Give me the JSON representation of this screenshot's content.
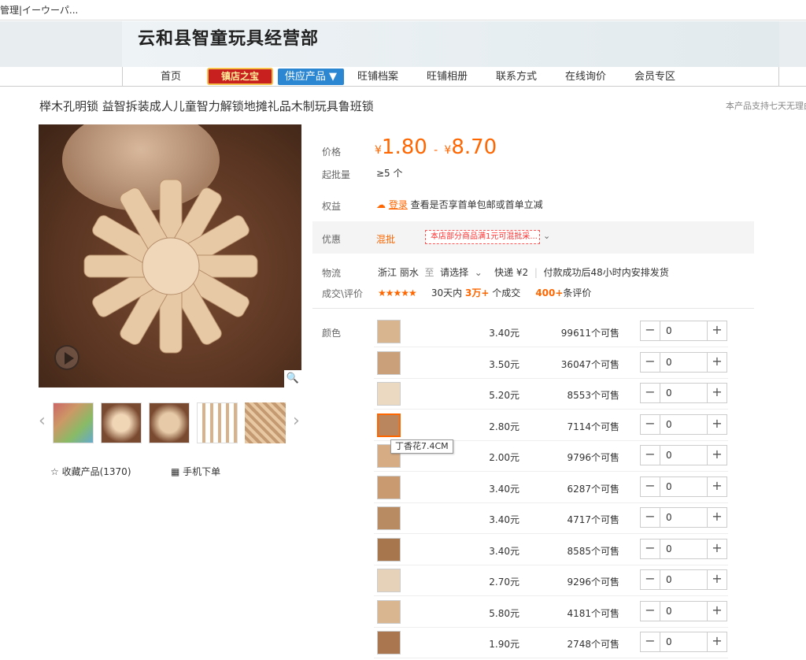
{
  "window": {
    "tab_title": "管理|イーウーパ..."
  },
  "shop": {
    "name": "云和县智童玩具经营部"
  },
  "nav": {
    "home": "首页",
    "treasure": "镇店之宝",
    "supply": "供应产品 ▼",
    "archive": "旺铺档案",
    "album": "旺铺相册",
    "contact": "联系方式",
    "inquiry": "在线询价",
    "member": "会员专区"
  },
  "product": {
    "title": "榉木孔明锁 益智拆装成人儿童智力解锁地摊礼品木制玩具鲁班锁",
    "support_note": "本产品支持七天无理由"
  },
  "gallery": {
    "collect": "收藏产品(1370)",
    "mobile": "手机下单"
  },
  "info": {
    "price_label": "价格",
    "price_low": "1.80",
    "price_sep": "-",
    "price_high": "8.70",
    "currency": "¥",
    "min_label": "起批量",
    "min_value": "≥5 个",
    "benefit_label": "权益",
    "benefit_link": "登录",
    "benefit_text": "查看是否享首单包邮或首单立减",
    "promo_label": "优惠",
    "promo_mix": "混批",
    "promo_tag": "本店部分商品满1元可混批采...",
    "logistics_label": "物流",
    "origin": "浙江 丽水",
    "to": "至",
    "dest": "请选择",
    "express": "快递 ¥2",
    "ship_note": "付款成功后48小时内安排发货",
    "deal_label": "成交\\评价",
    "days": "30天内",
    "deals": "3万+",
    "deals_unit": "个成交",
    "reviews": "400+",
    "reviews_unit": "条评价",
    "color_label": "颜色"
  },
  "rating": {
    "stars": 4.5,
    "stars_text": "★★★★★"
  },
  "tooltip": "丁香花7.4CM",
  "sku_unit": "个可售",
  "skus": [
    {
      "price": "3.40元",
      "stock": "99611",
      "qty": "0"
    },
    {
      "price": "3.50元",
      "stock": "36047",
      "qty": "0"
    },
    {
      "price": "5.20元",
      "stock": "8553",
      "qty": "0"
    },
    {
      "price": "2.80元",
      "stock": "7114",
      "qty": "0"
    },
    {
      "price": "2.00元",
      "stock": "9796",
      "qty": "0"
    },
    {
      "price": "3.40元",
      "stock": "6287",
      "qty": "0"
    },
    {
      "price": "3.40元",
      "stock": "4717",
      "qty": "0"
    },
    {
      "price": "3.40元",
      "stock": "8585",
      "qty": "0"
    },
    {
      "price": "2.70元",
      "stock": "9296",
      "qty": "0"
    },
    {
      "price": "5.80元",
      "stock": "4181",
      "qty": "0"
    },
    {
      "price": "1.90元",
      "stock": "2748",
      "qty": "0"
    }
  ],
  "colors": {
    "accent": "#ff6600",
    "nav_blue": "#2c87d3",
    "treasure_red": "#c81f1f"
  }
}
